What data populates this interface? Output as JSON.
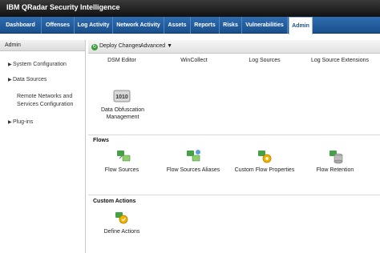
{
  "app": {
    "title": "IBM QRadar Security Intelligence"
  },
  "tabs": [
    {
      "label": "Dashboard"
    },
    {
      "label": "Offenses"
    },
    {
      "label": "Log Activity"
    },
    {
      "label": "Network Activity"
    },
    {
      "label": "Assets"
    },
    {
      "label": "Reports"
    },
    {
      "label": "Risks"
    },
    {
      "label": "Vulnerabilities"
    },
    {
      "label": "Admin"
    }
  ],
  "sidebar": {
    "header": "Admin",
    "items": [
      {
        "label": "System Configuration"
      },
      {
        "label": "Data Sources"
      },
      {
        "label": "Remote Networks and Services Configuration"
      },
      {
        "label": "Plug-ins"
      }
    ]
  },
  "toolbar": {
    "deploy_label": "Deploy Changes",
    "advanced_label": "Advanced ▼"
  },
  "data_sources": {
    "items": [
      {
        "label": "DSM Editor"
      },
      {
        "label": "WinCollect"
      },
      {
        "label": "Log Sources"
      },
      {
        "label": "Log Source Extensions"
      }
    ],
    "obfuscation": {
      "label_line1": "Data Obfuscation",
      "label_line2": "Management",
      "icon_text": "1010"
    }
  },
  "flows": {
    "title": "Flows",
    "items": [
      {
        "label": "Flow Sources"
      },
      {
        "label": "Flow Sources Aliases"
      },
      {
        "label": "Custom Flow Properties"
      },
      {
        "label": "Flow Retention"
      }
    ]
  },
  "custom_actions": {
    "title": "Custom Actions",
    "items": [
      {
        "label": "Define Actions"
      }
    ]
  }
}
